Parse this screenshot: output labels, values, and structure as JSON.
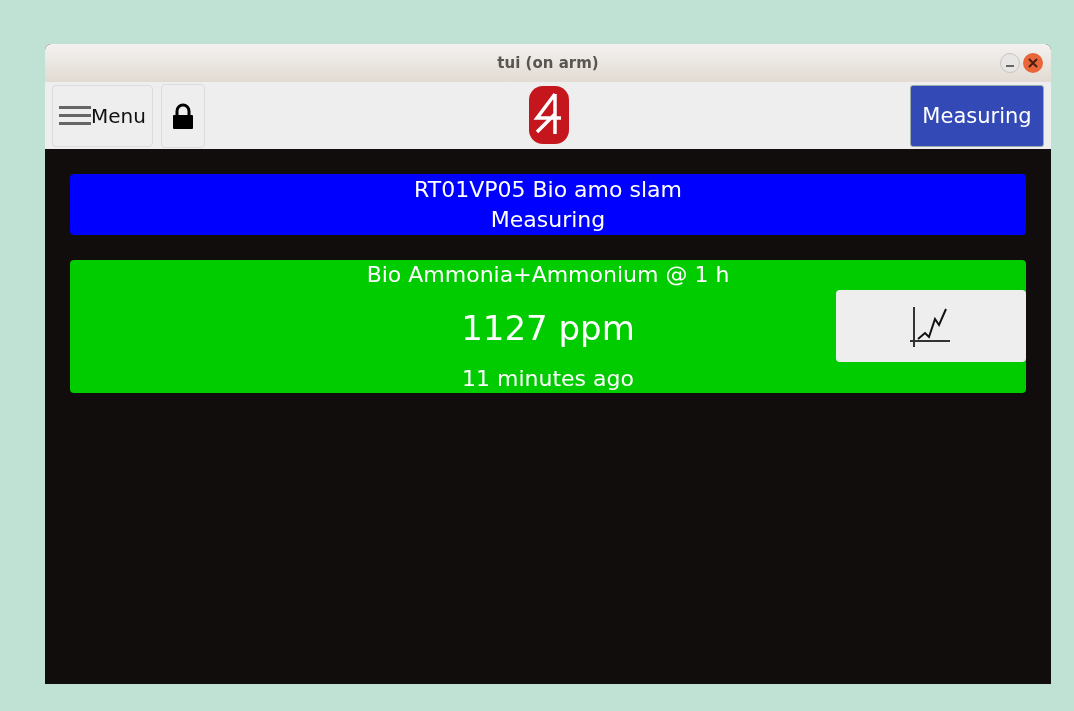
{
  "window": {
    "title": "tui (on arm)"
  },
  "toolbar": {
    "menu_button": "Menu",
    "mode_button": "Measuring"
  },
  "status_banner": {
    "lines": [
      "RT01VP05 Bio amo slam",
      "Measuring"
    ]
  },
  "measurements": [
    {
      "title": "Bio Ammonia+Ammonium @ 1 h",
      "value": "1127 ppm",
      "age": "11 minutes ago"
    }
  ]
}
